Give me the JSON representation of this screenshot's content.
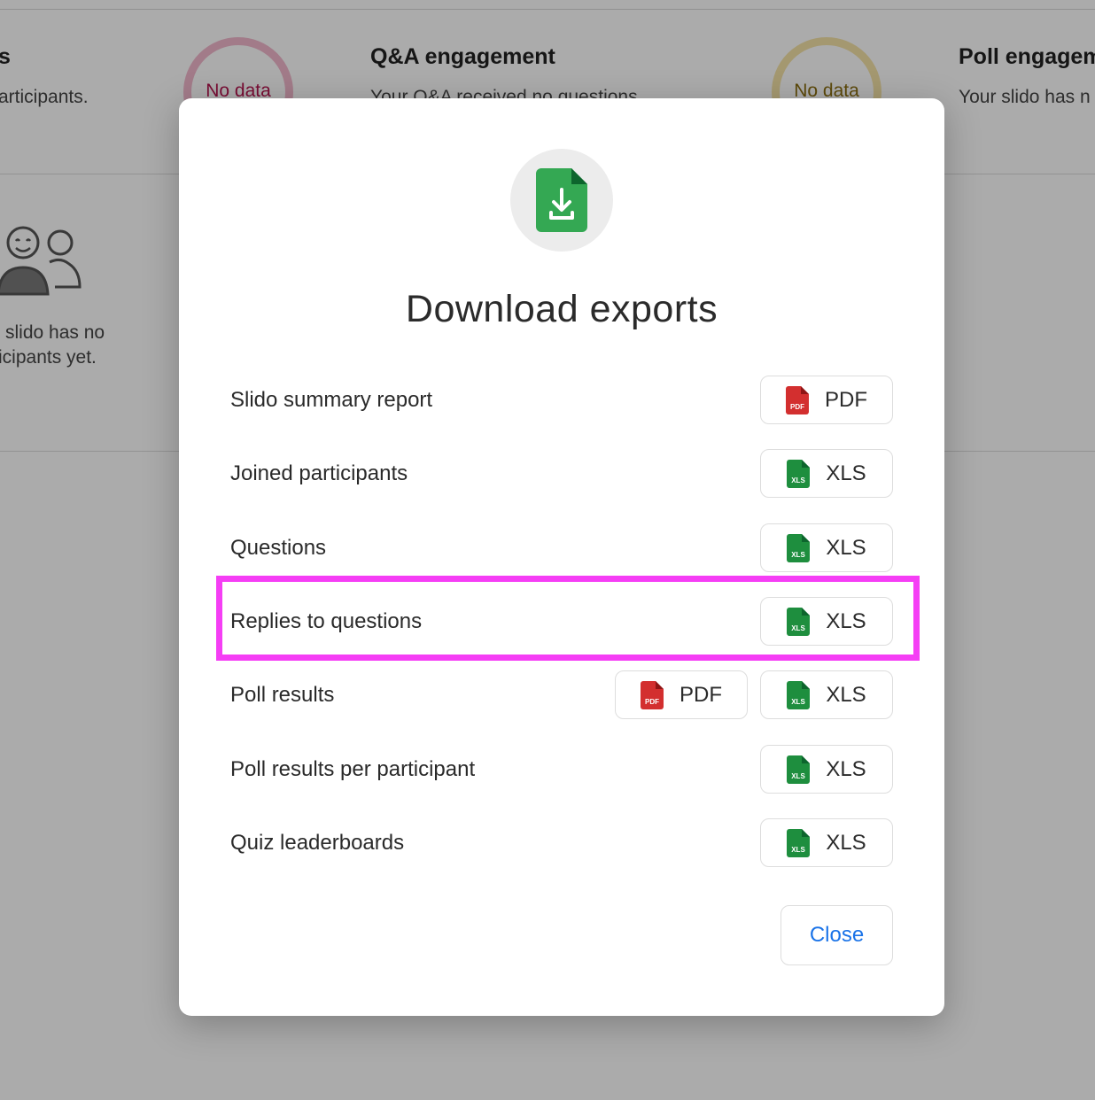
{
  "background": {
    "col1": {
      "heading": "s",
      "subtitle": "articipants."
    },
    "col2": {
      "heading": "Q&A engagement",
      "subtitle": "Your Q&A received no questions",
      "ring_label": "No data"
    },
    "col3": {
      "heading": "Poll engagem",
      "subtitle": "Your slido has n",
      "ring_label": "No data"
    },
    "empty_state": {
      "line1": "slido has no",
      "line2": "icipants yet."
    }
  },
  "modal": {
    "title": "Download exports",
    "rows": [
      {
        "label": "Slido summary report",
        "buttons": [
          "PDF"
        ]
      },
      {
        "label": "Joined participants",
        "buttons": [
          "XLS"
        ]
      },
      {
        "label": "Questions",
        "buttons": [
          "XLS"
        ]
      },
      {
        "label": "Replies to questions",
        "buttons": [
          "XLS"
        ]
      },
      {
        "label": "Poll results",
        "buttons": [
          "PDF",
          "XLS"
        ]
      },
      {
        "label": "Poll results per participant",
        "buttons": [
          "XLS"
        ]
      },
      {
        "label": "Quiz leaderboards",
        "buttons": [
          "XLS"
        ]
      }
    ],
    "close_label": "Close"
  },
  "icons": {
    "pdf": "pdf-file-icon",
    "xls": "xls-file-icon",
    "header": "download-file-icon"
  },
  "colors": {
    "accent": "#1a73e8",
    "highlight": "#f53ef5",
    "pdf_red": "#d32f2f",
    "xls_green": "#1e8e3e",
    "header_icon_green": "#34a853"
  }
}
